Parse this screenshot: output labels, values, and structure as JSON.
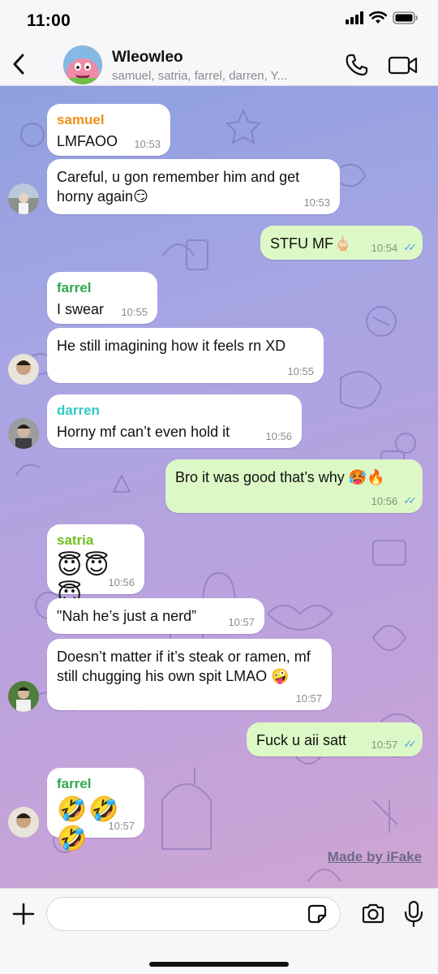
{
  "status_bar": {
    "time": "11:00",
    "icons": [
      "signal-icon",
      "wifi-icon",
      "battery-icon"
    ]
  },
  "header": {
    "back_icon": "chevron-left-icon",
    "group_name": "Wleowleo",
    "members": "samuel, satria, farrel, darren, Y...",
    "call_icon": "phone-icon",
    "video_icon": "video-camera-icon"
  },
  "colors": {
    "outgoing_bubble": "#dcf8c6",
    "incoming_bubble": "#ffffff",
    "samuel": "#f0901a",
    "farrel": "#2fa84f",
    "darren": "#34c7c9",
    "satria": "#6fc11f",
    "read_ticks": "#4f9fe6"
  },
  "messages": [
    {
      "direction": "in",
      "sender": "samuel",
      "text": "LMFAOO",
      "time": "10:53"
    },
    {
      "direction": "in",
      "sender": "",
      "text": "Careful, u gon remember him and get horny again😏",
      "time": "10:53"
    },
    {
      "direction": "out",
      "text": "STFU MF🖕🏻",
      "time": "10:54",
      "read": true
    },
    {
      "direction": "in",
      "sender": "farrel",
      "text": "I swear",
      "time": "10:55"
    },
    {
      "direction": "in",
      "sender": "",
      "text": "He still imagining how it feels rn XD",
      "time": "10:55"
    },
    {
      "direction": "in",
      "sender": "darren",
      "text": "Horny mf can’t even hold it",
      "time": "10:56"
    },
    {
      "direction": "out",
      "text": "Bro it was good that’s why 🥵🔥",
      "time": "10:56",
      "read": true
    },
    {
      "direction": "in",
      "sender": "satria",
      "text": "😇😇😇",
      "time": "10:56"
    },
    {
      "direction": "in",
      "sender": "",
      "text": "\"Nah he’s just a nerd”",
      "time": "10:57"
    },
    {
      "direction": "in",
      "sender": "",
      "text": "Doesn’t matter if it’s steak or ramen, mf still chugging his own spit LMAO 🤪",
      "time": "10:57"
    },
    {
      "direction": "out",
      "text": "Fuck u aii satt",
      "time": "10:57",
      "read": true
    },
    {
      "direction": "in",
      "sender": "farrel",
      "text": "🤣🤣🤣",
      "time": "10:57"
    }
  ],
  "watermark": "Made by iFake",
  "composer": {
    "plus_icon": "plus-icon",
    "input_value": "",
    "input_placeholder": "",
    "sticker_icon": "sticker-icon",
    "camera_icon": "camera-icon",
    "mic_icon": "microphone-icon"
  }
}
